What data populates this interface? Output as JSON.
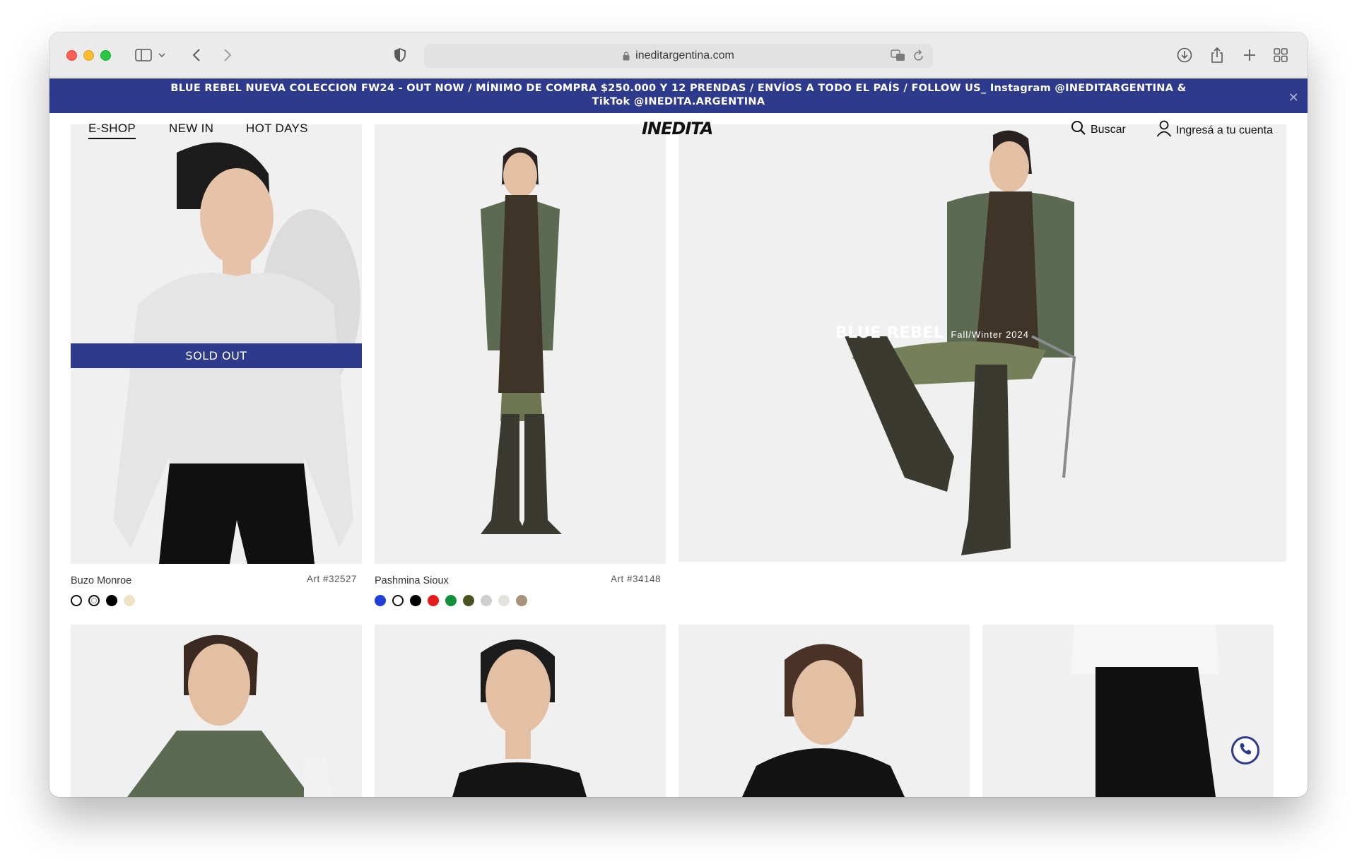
{
  "browser": {
    "url": "ineditargentina.com"
  },
  "promo": {
    "line1": "BLUE REBEL NUEVA COLECCION FW24 - OUT NOW / MÍNIMO DE COMPRA $250.000 Y 12 PRENDAS / ENVÍOS A TODO EL PAÍS / FOLLOW US_  Instagram @INEDITARGENTINA &",
    "line2": "TikTok @INEDITA.ARGENTINA",
    "close": "✕"
  },
  "nav": {
    "links": [
      "E-SHOP",
      "NEW IN",
      "HOT DAYS"
    ],
    "logo": "INEDITA",
    "search": "Buscar",
    "account": "Ingresá a tu cuenta"
  },
  "products": [
    {
      "name": "Buzo Monroe",
      "art": "Art #32527",
      "sold_out": "SOLD OUT",
      "swatches": [
        "#ffffff",
        "#ffffff",
        "#000000",
        "#efe3c6"
      ]
    },
    {
      "name": "Pashmina Sioux",
      "art": "Art #34148",
      "swatches": [
        "#1f3fd8",
        "#ffffff",
        "#000000",
        "#e61c1c",
        "#138f3a",
        "#4b5320",
        "#cfcfcf",
        "#e4e2dc",
        "#a8937d"
      ]
    }
  ],
  "hero": {
    "title": "BLUE REBEL",
    "subtitle": "Fall/Winter 2024"
  },
  "colors": {
    "brand_blue": "#2e3a8c"
  },
  "icons": [
    "sidebar-icon",
    "chevron-down-icon",
    "back-icon",
    "forward-icon",
    "shield-icon",
    "lock-icon",
    "translate-icon",
    "reload-icon",
    "download-icon",
    "share-icon",
    "plus-icon",
    "tabs-grid-icon",
    "search-icon",
    "user-icon",
    "close-icon",
    "whatsapp-icon"
  ]
}
